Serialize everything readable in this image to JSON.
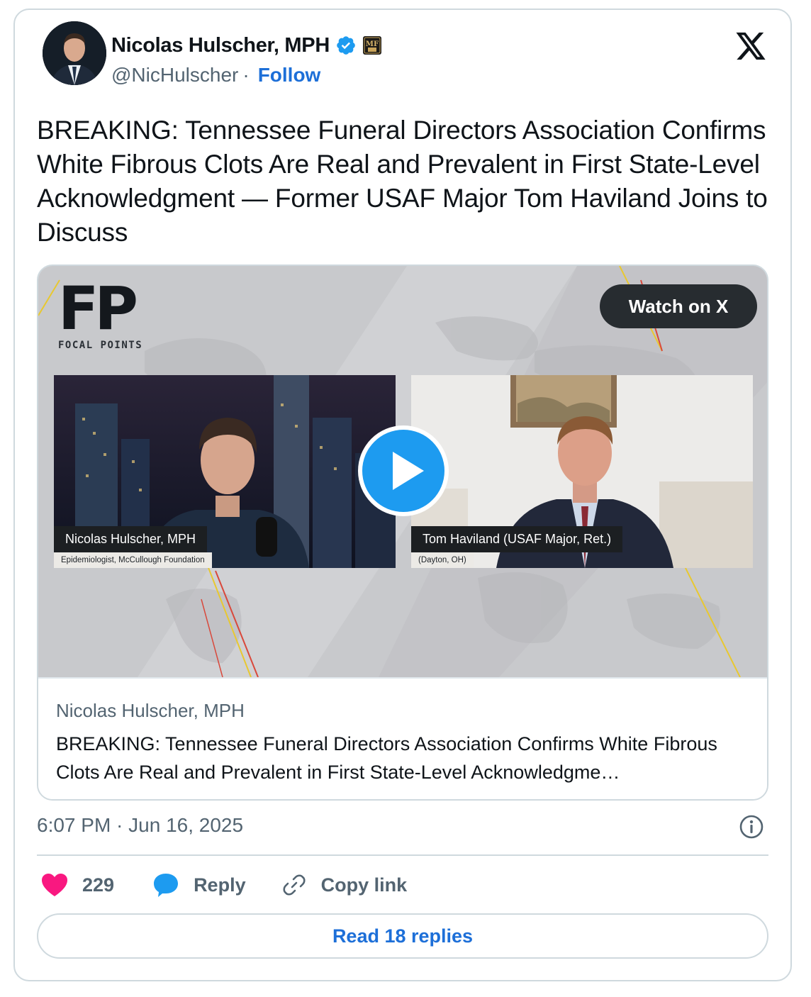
{
  "author": {
    "name": "Nicolas Hulscher, MPH",
    "handle": "@NicHulscher",
    "separator": "·",
    "follow_label": "Follow",
    "badge_text": "MF"
  },
  "tweet": {
    "text": "BREAKING: Tennessee Funeral Directors Association Confirms White Fibrous Clots Are Real and Prevalent in First State-Level Acknowledgment — Former USAF Major Tom Haviland Joins to Discuss"
  },
  "media": {
    "watch_label": "Watch on X",
    "logo_letters": "FP",
    "logo_caption": "FOCAL POINTS",
    "left_feed": {
      "name": "Nicolas Hulscher, MPH",
      "subtitle": "Epidemiologist, McCullough Foundation"
    },
    "right_feed": {
      "name": "Tom Haviland (USAF Major, Ret.)",
      "subtitle": "(Dayton, OH)"
    },
    "card_source": "Nicolas Hulscher, MPH",
    "card_description": "BREAKING: Tennessee Funeral Directors Association Confirms White Fibrous Clots Are Real and Prevalent in First State-Level Acknowledgme…"
  },
  "meta": {
    "timestamp": "6:07 PM · Jun 16, 2025"
  },
  "actions": {
    "likes": "229",
    "reply_label": "Reply",
    "copy_label": "Copy link",
    "read_replies_label": "Read 18 replies"
  },
  "colors": {
    "link_blue": "#1d6fd8",
    "verified_blue": "#1d9bf0",
    "like_pink": "#f91880",
    "muted_text": "#536471"
  },
  "icons": [
    "x-logo-icon",
    "verified-badge-icon",
    "mf-badge-icon",
    "play-icon",
    "info-icon",
    "heart-icon",
    "reply-bubble-icon",
    "link-icon"
  ]
}
